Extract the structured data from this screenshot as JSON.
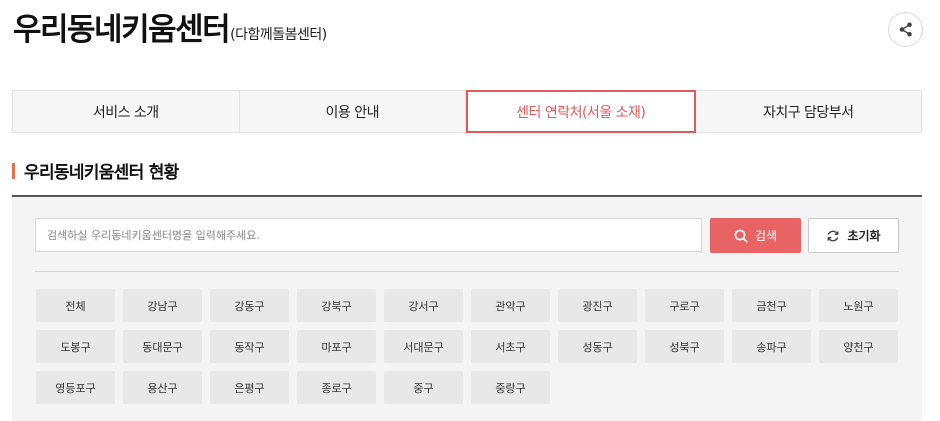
{
  "header": {
    "title": "우리동네키움센터",
    "subtitle": "(다함께돌봄센터)"
  },
  "tabs": [
    {
      "label": "서비스 소개",
      "active": false
    },
    {
      "label": "이용 안내",
      "active": false
    },
    {
      "label": "센터 연락처(서울 소재)",
      "active": true
    },
    {
      "label": "자치구 담당부서",
      "active": false
    }
  ],
  "section": {
    "title": "우리동네키움센터 현황"
  },
  "search": {
    "placeholder": "검색하실 우리동네키움센터명을 입력해주세요.",
    "value": "",
    "search_label": "검색",
    "reset_label": "초기화"
  },
  "districts": [
    "전체",
    "강남구",
    "강동구",
    "강북구",
    "강서구",
    "관악구",
    "광진구",
    "구로구",
    "금천구",
    "노원구",
    "도봉구",
    "동대문구",
    "동작구",
    "마포구",
    "서대문구",
    "서초구",
    "성동구",
    "성북구",
    "송파구",
    "양천구",
    "영등포구",
    "용산구",
    "은평구",
    "종로구",
    "중구",
    "중랑구"
  ],
  "colors": {
    "accent": "#e25a5a",
    "search_button": "#e86464",
    "section_marker": "#e8704a"
  }
}
